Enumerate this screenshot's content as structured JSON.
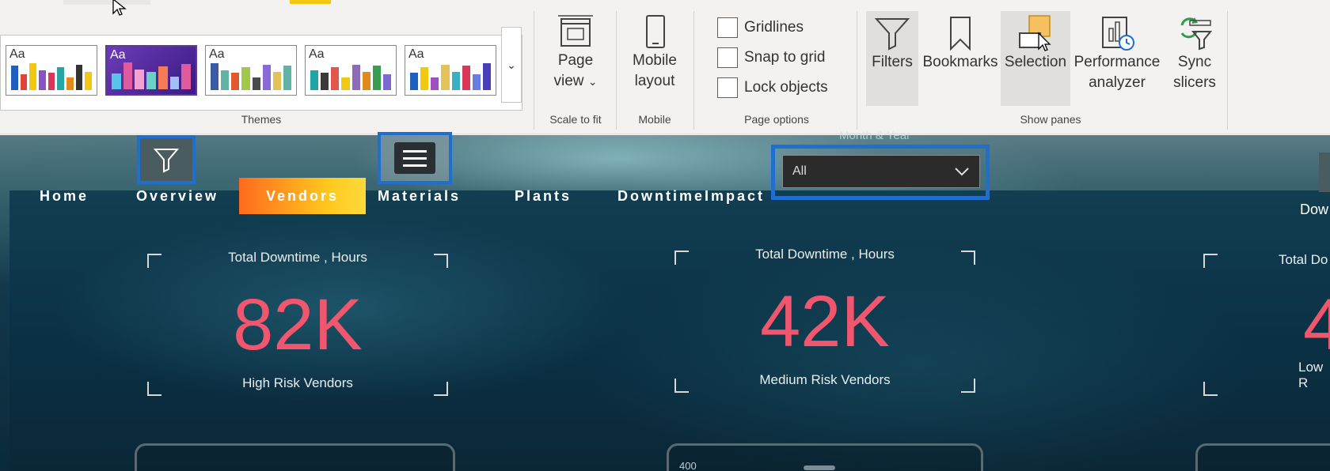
{
  "ribbon": {
    "themes": {
      "group_label": "Themes",
      "aa": "Aa",
      "items": [
        {
          "bars": [
            "#1f5fbf",
            "#e0443a",
            "#f2c811",
            "#8a52c7",
            "#d9365a",
            "#26a5a5",
            "#e08a1e",
            "#333",
            "#f2c811"
          ]
        },
        {
          "bars": [
            "#58c4e8",
            "#e05a9e",
            "#f2a1d2",
            "#6dd0c6",
            "#f37b55",
            "#a2c0f6",
            "#e05a9e"
          ]
        },
        {
          "bars": [
            "#3b5aa6",
            "#60b3a5",
            "#e05a2d",
            "#a0c94a",
            "#4b4b4b",
            "#8a6ad4",
            "#e3c25a",
            "#60b3a5"
          ]
        },
        {
          "bars": [
            "#1fa5a6",
            "#3a3a3a",
            "#e3574a",
            "#f2c811",
            "#8e6bb4",
            "#e08a1e",
            "#3a9e52",
            "#7b6bcf"
          ]
        },
        {
          "bars": [
            "#1f5fbf",
            "#f2c811",
            "#9e4fc0",
            "#e3c25a",
            "#3bb0c5",
            "#d9365a",
            "#6b7ce0",
            "#4a3fb8"
          ]
        }
      ],
      "more_glyph": "⌄"
    },
    "scale_to_fit": {
      "label_line1": "Page",
      "label_line2": "view",
      "chevron": "⌄",
      "group_label": "Scale to fit"
    },
    "mobile": {
      "label_line1": "Mobile",
      "label_line2": "layout",
      "group_label": "Mobile"
    },
    "page_options": {
      "gridlines": "Gridlines",
      "snap": "Snap to grid",
      "lock": "Lock objects",
      "group_label": "Page options"
    },
    "show_panes": {
      "filters": "Filters",
      "bookmarks": "Bookmarks",
      "selection": "Selection",
      "perf_line1": "Performance",
      "perf_line2": "analyzer",
      "sync_line1": "Sync",
      "sync_line2": "slicers",
      "group_label": "Show panes"
    }
  },
  "canvas": {
    "slicer": {
      "title": "Month & Year",
      "value": "All"
    },
    "nav": [
      "Home",
      "Overview",
      "Vendors",
      "Materials",
      "Plants",
      "DowntimeImpact"
    ],
    "active_nav": "Vendors",
    "right_clip": "Dow",
    "cards": [
      {
        "title": "Total Downtime , Hours",
        "value": "82K",
        "subtitle": "High Risk Vendors"
      },
      {
        "title": "Total Downtime , Hours",
        "value": "42K",
        "subtitle": "Medium Risk Vendors"
      },
      {
        "title": "Total Do",
        "value": "4",
        "subtitle": "Low R"
      }
    ],
    "axis_tick": "400"
  },
  "colors": {
    "accent": "#1f6fd1",
    "kpi": "#f0566e",
    "active_nav_start": "#ff6a1e",
    "active_nav_end": "#ffd93a"
  }
}
